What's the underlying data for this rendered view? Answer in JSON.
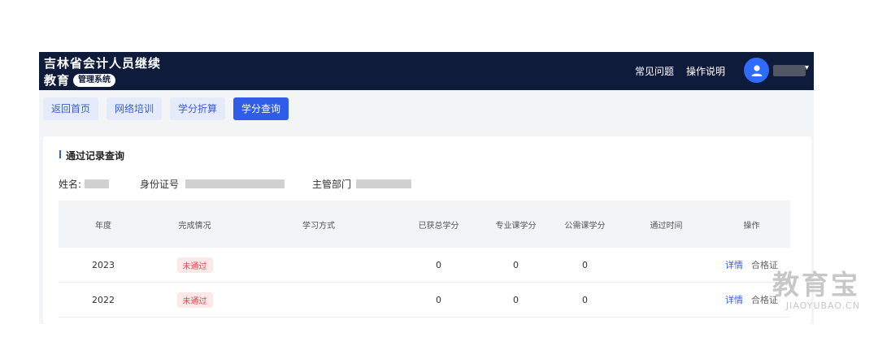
{
  "header": {
    "brand_line1": "吉林省会计人员继续",
    "brand_line2": "教育",
    "brand_badge": "管理系统",
    "faq_link": "常见问题",
    "guide_link": "操作说明",
    "avatar_icon": "user-avatar-icon",
    "user_menu_icon": "chevron-down-icon"
  },
  "tabs": [
    {
      "label": "返回首页",
      "active": false
    },
    {
      "label": "网络培训",
      "active": false
    },
    {
      "label": "学分折算",
      "active": false
    },
    {
      "label": "学分查询",
      "active": true
    }
  ],
  "section": {
    "title": "通过记录查询",
    "name_label": "姓名:",
    "id_label": "身份证号",
    "dept_label": "主管部门"
  },
  "table": {
    "headers": [
      "年度",
      "完成情况",
      "学习方式",
      "已获总学分",
      "专业课学分",
      "公需课学分",
      "通过时间",
      "操作"
    ],
    "rows": [
      {
        "year": "2023",
        "status": "未通过",
        "method": "",
        "total": "0",
        "professional": "0",
        "public": "0",
        "time": "",
        "detail": "详情",
        "cert": "合格证"
      },
      {
        "year": "2022",
        "status": "未通过",
        "method": "",
        "total": "0",
        "professional": "0",
        "public": "0",
        "time": "",
        "detail": "详情",
        "cert": "合格证"
      }
    ]
  },
  "watermark": {
    "main": "教育宝",
    "sub": "JIAOYUBAO.CN"
  },
  "colors": {
    "header_bg": "#0f1b3a",
    "accent": "#2f5ce8",
    "status_fail": "#e0474c"
  }
}
